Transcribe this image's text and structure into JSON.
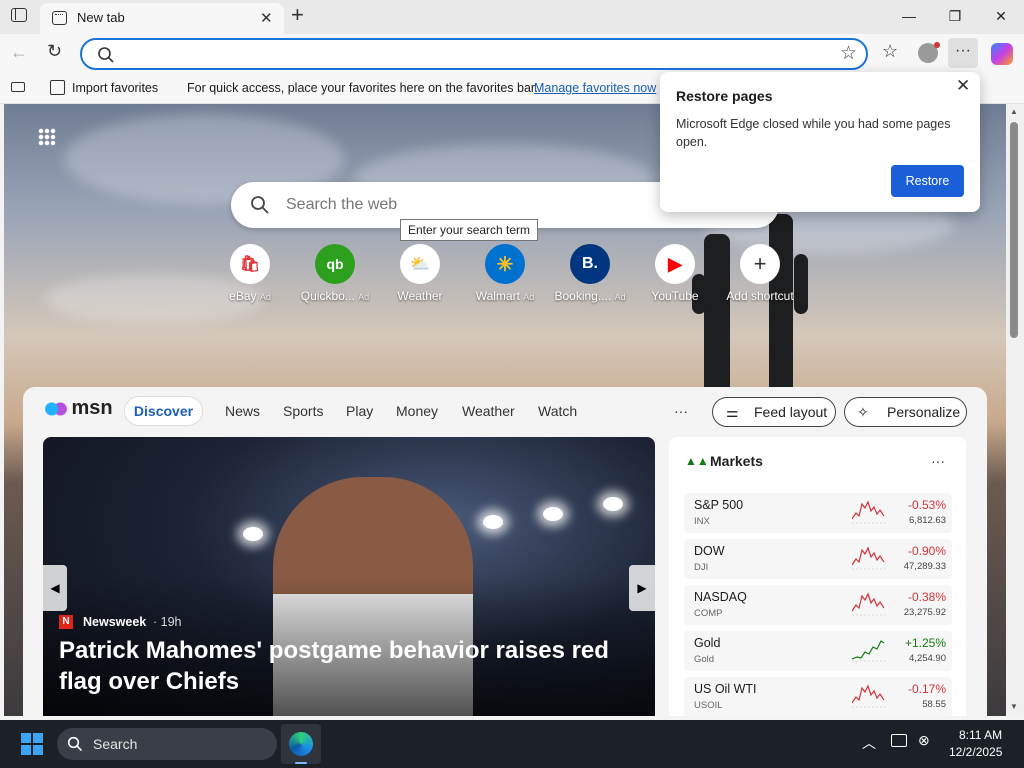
{
  "browser": {
    "tab_title": "New tab",
    "address_value": ""
  },
  "favorites_bar": {
    "import_label": "Import favorites",
    "message": "For quick access, place your favorites here on the favorites bar.",
    "manage_link": "Manage favorites now"
  },
  "newtab": {
    "search_placeholder": "Search the web",
    "tooltip": "Enter your search term",
    "shortcuts": [
      {
        "label": "eBay",
        "ad": "Ad"
      },
      {
        "label": "Quickbo...",
        "ad": "Ad"
      },
      {
        "label": "Weather",
        "ad": ""
      },
      {
        "label": "Walmart",
        "ad": "Ad"
      },
      {
        "label": "Booking....",
        "ad": "Ad"
      },
      {
        "label": "YouTube",
        "ad": ""
      },
      {
        "label": "Add shortcut",
        "ad": ""
      }
    ]
  },
  "msn": {
    "brand": "msn",
    "nav": [
      "Discover",
      "News",
      "Sports",
      "Play",
      "Money",
      "Weather",
      "Watch"
    ],
    "more": "···",
    "feed_layout": "Feed layout",
    "personalize": "Personalize",
    "hero": {
      "source": "Newsweek",
      "age": "· 19h",
      "headline": "Patrick Mahomes' postgame behavior raises red flag over Chiefs"
    },
    "markets": {
      "title": "Markets",
      "more": "···",
      "rows": [
        {
          "name": "S&P 500",
          "symbol": "INX",
          "change": "-0.53%",
          "value": "6,812.63",
          "dir": "down"
        },
        {
          "name": "DOW",
          "symbol": "DJI",
          "change": "-0.90%",
          "value": "47,289.33",
          "dir": "down"
        },
        {
          "name": "NASDAQ",
          "symbol": "COMP",
          "change": "-0.38%",
          "value": "23,275.92",
          "dir": "down"
        },
        {
          "name": "Gold",
          "symbol": "Gold",
          "change": "+1.25%",
          "value": "4,254.90",
          "dir": "up"
        },
        {
          "name": "US Oil WTI",
          "symbol": "USOIL",
          "change": "-0.17%",
          "value": "58.55",
          "dir": "down"
        }
      ]
    }
  },
  "restore_popup": {
    "title": "Restore pages",
    "body": "Microsoft Edge closed while you had some pages open.",
    "button": "Restore"
  },
  "taskbar": {
    "search_label": "Search",
    "time": "8:11 AM",
    "date": "12/2/2025"
  },
  "colors": {
    "accent": "#1a73d8",
    "down": "#d13438",
    "up": "#107c10"
  }
}
